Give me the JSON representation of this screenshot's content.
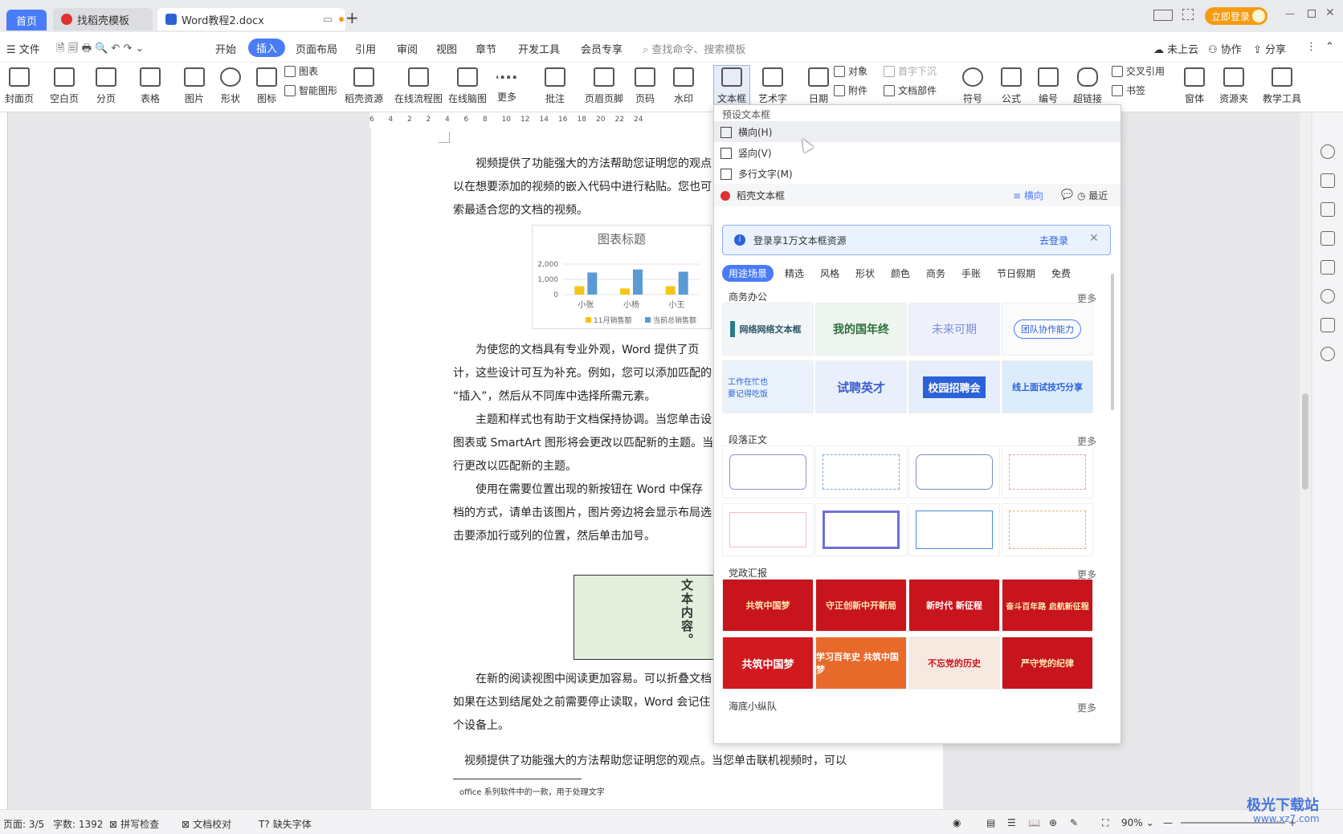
{
  "tabs": {
    "home": "首页",
    "template": "找稻壳模板",
    "document": "Word教程2.docx",
    "add": "+"
  },
  "titlebar": {
    "login": "立即登录"
  },
  "menu": {
    "file": "文件",
    "items": [
      "开始",
      "插入",
      "页面布局",
      "引用",
      "审阅",
      "视图",
      "章节",
      "开发工具",
      "会员专享"
    ],
    "search": "查找命令、搜索模板",
    "cloud": "未上云",
    "collab": "协作",
    "share": "分享"
  },
  "toolbar": {
    "cover": "封面页",
    "blank": "空白页",
    "pagebreak": "分页",
    "table": "表格",
    "image": "图片",
    "shape": "形状",
    "icon": "图标",
    "chart": "图表",
    "smartshape": "智能图形",
    "docer": "稻壳资源",
    "flowchart": "在线流程图",
    "mindmap": "在线脑图",
    "more": "更多",
    "comment": "批注",
    "headerfooter": "页眉页脚",
    "pagenum": "页码",
    "watermark": "水印",
    "textbox": "文本框",
    "wordart": "艺术字",
    "date": "日期",
    "object": "对象",
    "attach": "附件",
    "dropcap": "首字下沉",
    "docpart": "文档部件",
    "symbol": "符号",
    "formula": "公式",
    "number": "编号",
    "hyperlink": "超链接",
    "crossref": "交叉引用",
    "bookmark": "书签",
    "form": "窗体",
    "resource": "资源夹",
    "teaching": "教学工具"
  },
  "ruler": [
    "6",
    "4",
    "2",
    "2",
    "4",
    "6",
    "8",
    "10",
    "12",
    "14",
    "16",
    "18",
    "20",
    "22",
    "24"
  ],
  "document": {
    "p1": [
      "视频提供了功能强大的方法帮助您证明您的观点",
      "以在想要添加的视频的嵌入代码中进行粘贴。您也可",
      "索最适合您的文档的视频。"
    ],
    "p2": [
      "为使您的文档具有专业外观，Word 提供了页",
      "计，这些设计可互为补充。例如，您可以添加匹配的",
      "“插入”，然后从不同库中选择所需元素。"
    ],
    "p3": [
      "主题和样式也有助于文档保持协调。当您单击设",
      "图表或 SmartArt 图形将会更改以匹配新的主题。当",
      "行更改以匹配新的主题。"
    ],
    "p4": [
      "使用在需要位置出现的新按钮在 Word 中保存",
      "档的方式，请单击该图片，图片旁边将会显示布局选",
      "击要添加行或列的位置，然后单击加号。"
    ],
    "p5": [
      "在新的阅读视图中阅读更加容易。可以折叠文档",
      "如果在达到结尾处之前需要停止读取，Word 会记住",
      "个设备上。"
    ],
    "p6": "视频提供了功能强大的方法帮助您证明您的观点。当您单击联机视频时，可以",
    "footnote": "office 系列软件中的一款，用于处理文字",
    "textbox": "文本内容。"
  },
  "chart_data": {
    "type": "bar",
    "title": "图表标题",
    "categories": [
      "小张",
      "小杨",
      "小王"
    ],
    "series": [
      {
        "name": "11月销售额",
        "values": [
          550,
          400,
          550
        ]
      },
      {
        "name": "当前总销售额",
        "values": [
          1450,
          1650,
          1500
        ]
      }
    ],
    "yticks": [
      "2,000",
      "1,000",
      "0"
    ],
    "ylim": [
      0,
      2000
    ],
    "colors": [
      "#f5c518",
      "#5b9bd5"
    ]
  },
  "dropdown": {
    "preset_header": "预设文本框",
    "horizontal": "横向(H)",
    "vertical": "竖向(V)",
    "multiline": "多行文字(M)",
    "docer_textbox": "稻壳文本框",
    "filter_horizontal": "横向",
    "recent": "最近",
    "banner_text": "登录享1万文本框资源",
    "banner_login": "去登录",
    "categories": [
      "用途场景",
      "精选",
      "风格",
      "形状",
      "颜色",
      "商务",
      "手账",
      "节日假期",
      "免费"
    ],
    "sections": [
      "商务办公",
      "段落正文",
      "党政汇报",
      "海底小纵队"
    ],
    "more": "更多",
    "business_thumbs": [
      "网络网络文本框",
      "我的国年终",
      "未来可期",
      "团队协作能力",
      "工作在忙也要记得吃饭",
      "试聘英才",
      "校园招聘会",
      "线上面试技巧分享"
    ],
    "party_thumbs": [
      "共筑中国梦",
      "守正创新中开新局",
      "新时代 新征程",
      "奋斗百年路 启航新征程",
      "共筑中国梦",
      "学习百年史 共筑中国梦",
      "不忘党的历史",
      "严守党的纪律"
    ]
  },
  "status": {
    "page": "页面: 3/5",
    "words": "字数: 1392",
    "spell": "拼写检查",
    "proof": "文档校对",
    "missingfont": "缺失字体",
    "zoom": "90%"
  },
  "watermark": {
    "name": "极光下载站",
    "url": "www.xz7.com"
  }
}
